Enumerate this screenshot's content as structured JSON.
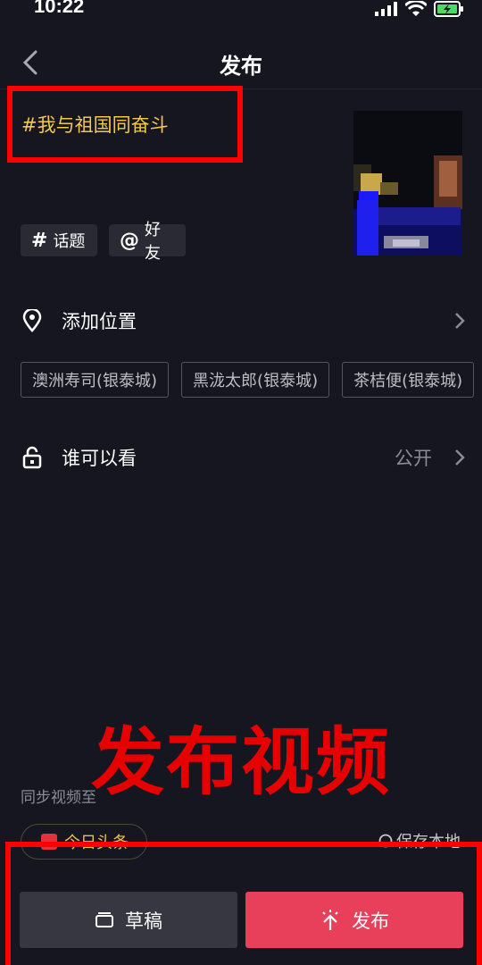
{
  "status_bar": {
    "time": "10:22",
    "icons": [
      "signal-icon",
      "wifi-icon",
      "battery-charging-icon"
    ],
    "battery_color": "#4cd964"
  },
  "nav": {
    "title": "发布",
    "back_icon": "chevron-left-icon"
  },
  "caption": "#我与祖国同奋斗",
  "chips": [
    {
      "symbol": "#",
      "label": "话题"
    },
    {
      "symbol": "@",
      "label": "好友"
    }
  ],
  "location": {
    "label": "添加位置",
    "icon": "location-pin-icon",
    "suggestions": [
      "澳洲寿司(银泰城)",
      "黑泷太郎(银泰城)",
      "茶桔便(银泰城)"
    ]
  },
  "visibility": {
    "label": "谁可以看",
    "value": "公开",
    "icon": "unlock-icon"
  },
  "overlay_text": "发布视频",
  "sync": {
    "label": "同步视频至",
    "platform": "今日头条",
    "save_local": "保存本地"
  },
  "buttons": {
    "draft": "草稿",
    "publish": "发布"
  },
  "colors": {
    "background": "#161621",
    "caption": "#f2c94c",
    "publish": "#e8405a",
    "annotation": "#ff0000"
  }
}
